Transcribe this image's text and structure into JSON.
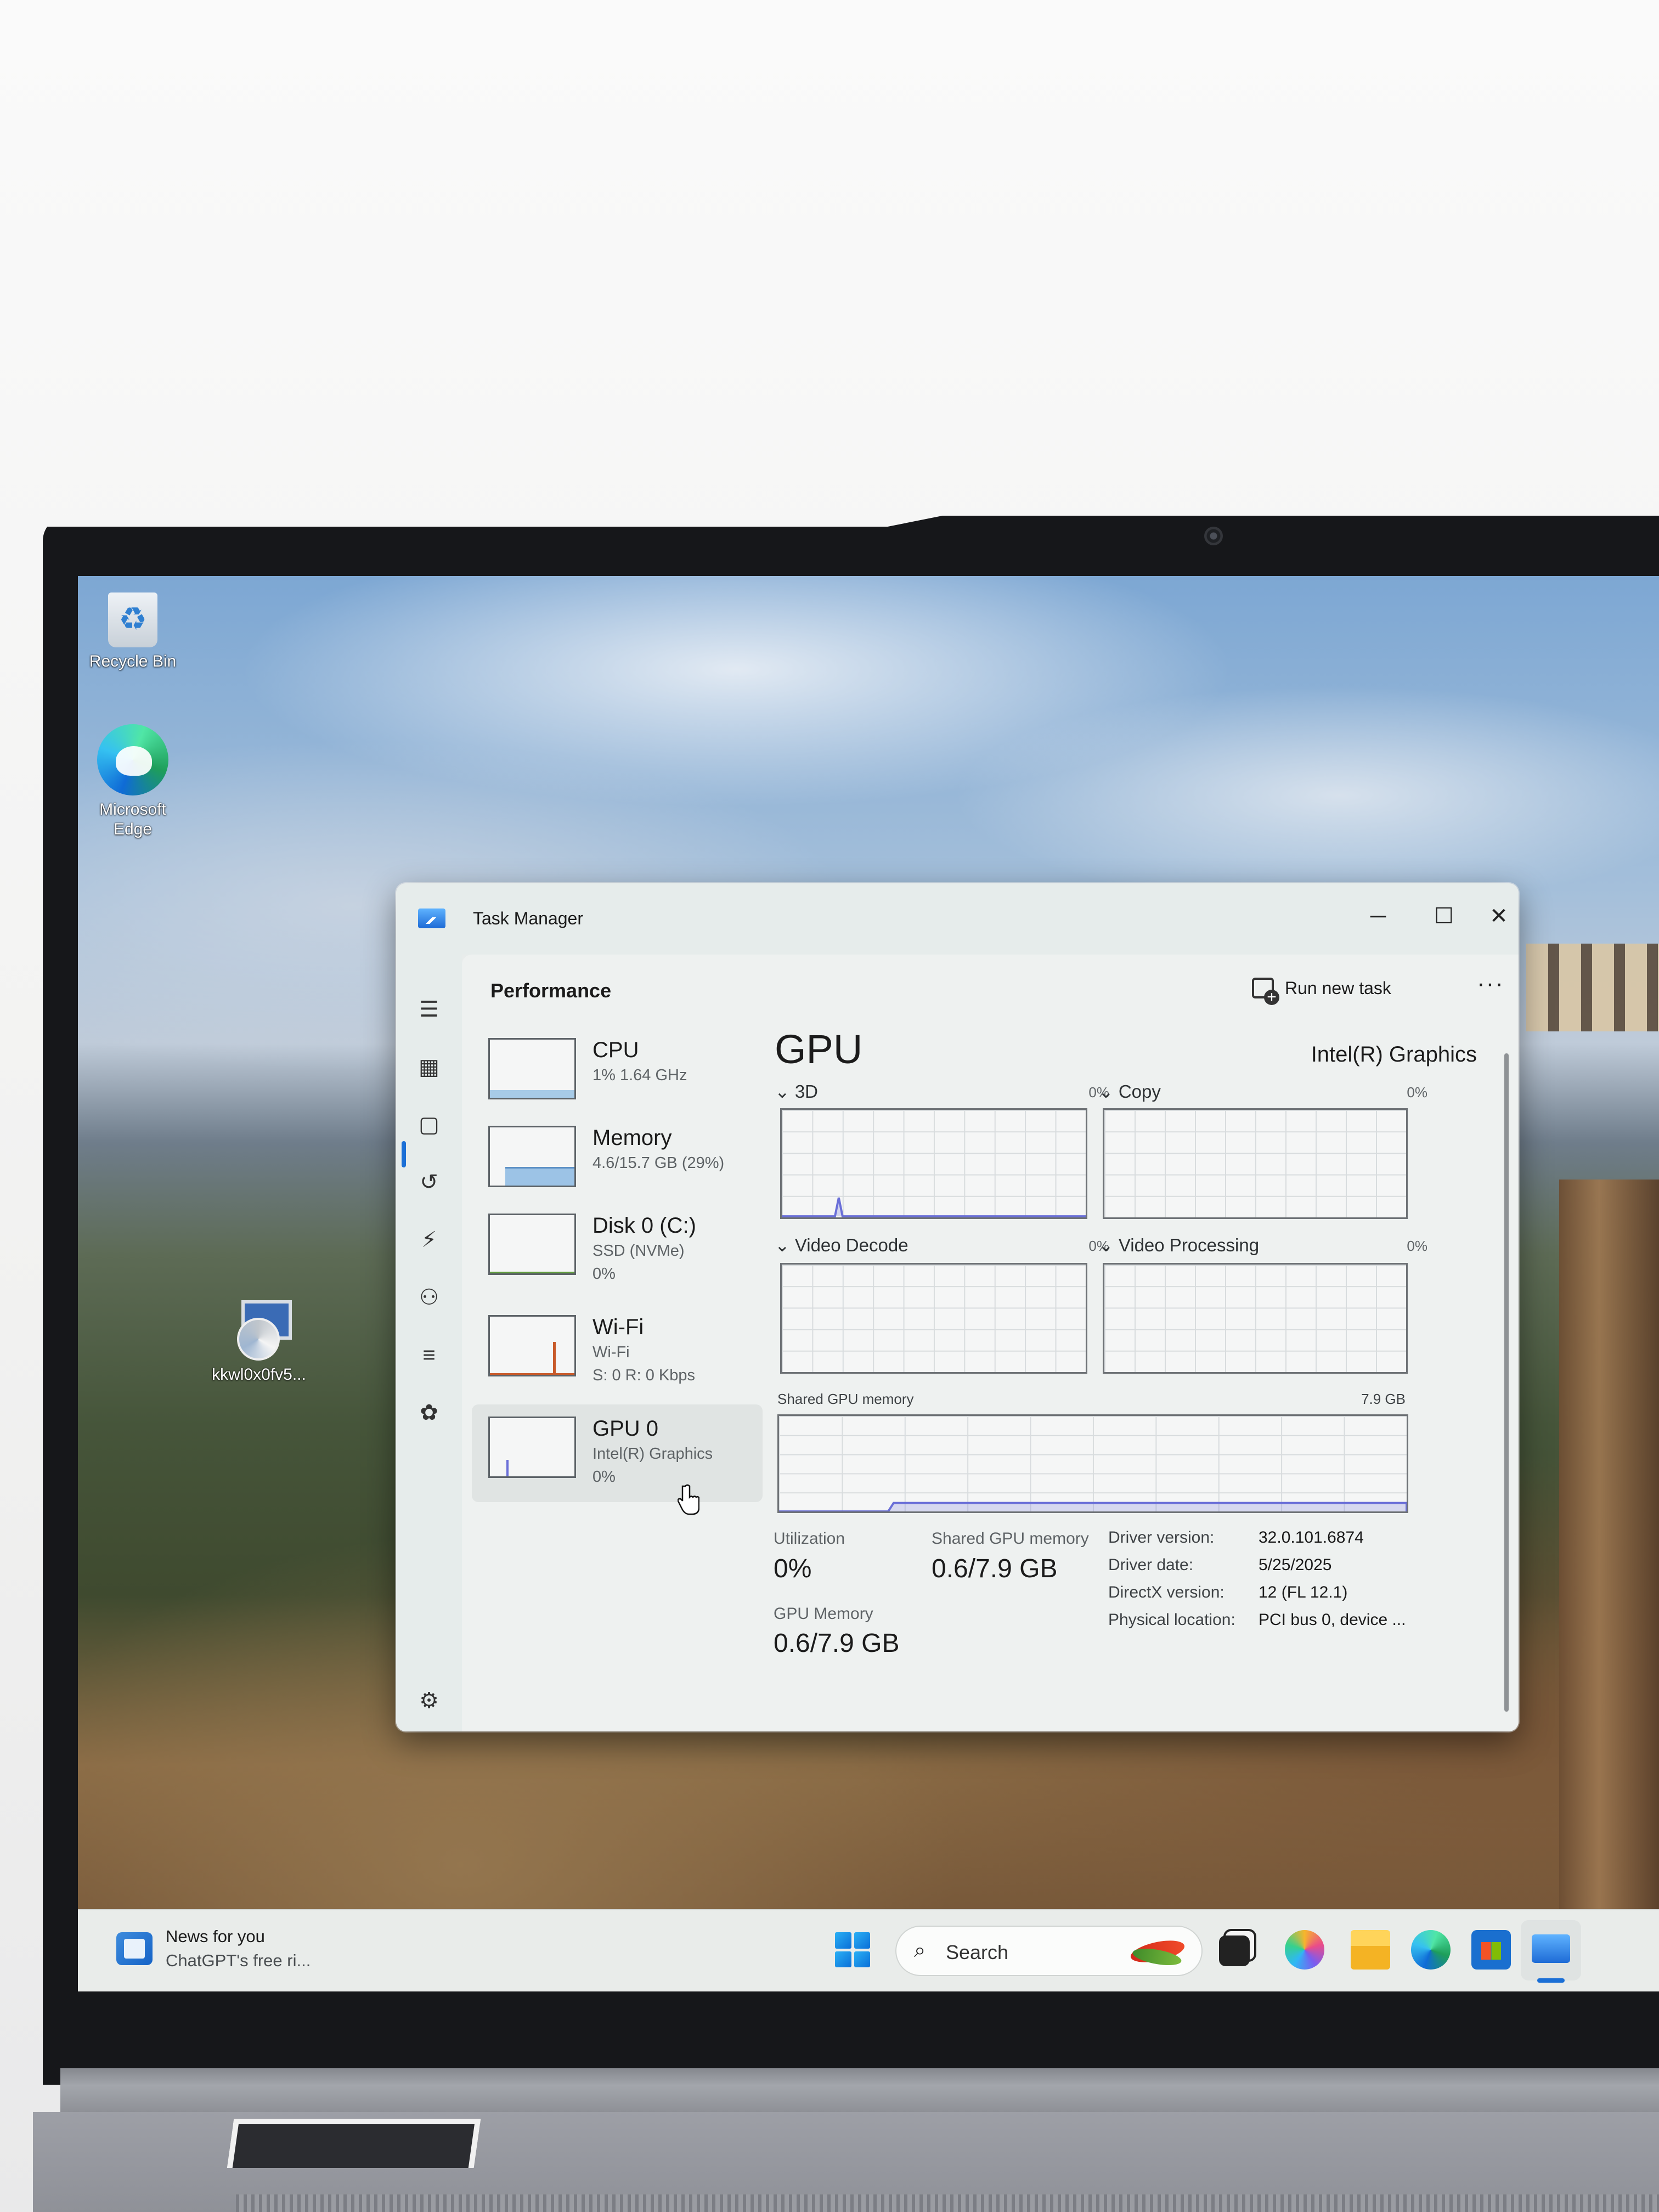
{
  "desktop": {
    "icons": [
      {
        "label": "Recycle Bin"
      },
      {
        "label": "Microsoft Edge"
      },
      {
        "label": "kkwl0x0fv5..."
      }
    ]
  },
  "window": {
    "title": "Task Manager",
    "section_title": "Performance",
    "run_new_task": "Run new task",
    "more": "···",
    "controls": {
      "minimize": "─",
      "maximize": "☐",
      "close": "✕"
    }
  },
  "nav_icons": [
    "menu-icon",
    "processes-icon",
    "performance-icon",
    "history-icon",
    "startup-icon",
    "users-icon",
    "details-icon",
    "services-icon",
    "settings-icon"
  ],
  "side_list": [
    {
      "name": "CPU",
      "sub1": "1% 1.64 GHz",
      "sub2": ""
    },
    {
      "name": "Memory",
      "sub1": "4.6/15.7 GB (29%)",
      "sub2": ""
    },
    {
      "name": "Disk 0 (C:)",
      "sub1": "SSD (NVMe)",
      "sub2": "0%"
    },
    {
      "name": "Wi-Fi",
      "sub1": "Wi-Fi",
      "sub2": "S: 0 R: 0 Kbps"
    },
    {
      "name": "GPU 0",
      "sub1": "Intel(R) Graphics",
      "sub2": "0%"
    }
  ],
  "gpu": {
    "heading": "GPU",
    "adapter": "Intel(R) Graphics",
    "engines": [
      {
        "label": "3D",
        "pct": "0%"
      },
      {
        "label": "Copy",
        "pct": "0%"
      },
      {
        "label": "Video Decode",
        "pct": "0%"
      },
      {
        "label": "Video Processing",
        "pct": "0%"
      }
    ],
    "shared_memory_label": "Shared GPU memory",
    "shared_memory_max": "7.9 GB",
    "stats": {
      "utilization_label": "Utilization",
      "utilization_value": "0%",
      "shared_label": "Shared GPU memory",
      "shared_value": "0.6/7.9 GB",
      "gpu_memory_label": "GPU Memory",
      "gpu_memory_value": "0.6/7.9 GB"
    },
    "specs": [
      {
        "label": "Driver version:",
        "value": "32.0.101.6874"
      },
      {
        "label": "Driver date:",
        "value": "5/25/2025"
      },
      {
        "label": "DirectX version:",
        "value": "12 (FL 12.1)"
      },
      {
        "label": "Physical location:",
        "value": "PCI bus 0, device ..."
      }
    ]
  },
  "taskbar": {
    "news_title": "News for you",
    "news_sub": "ChatGPT's free ri...",
    "search_placeholder": "Search"
  },
  "colors": {
    "accent": "#1b6fd6",
    "window_bg": "#e8eceb",
    "graph_line": "#6a6fd8",
    "cpu_fill": "#5aa0d8",
    "memory_fill": "#9cc3e6",
    "disk_line": "#5f9e3c",
    "wifi_line": "#c85a2a",
    "gpu_line": "#6a6fd8"
  }
}
